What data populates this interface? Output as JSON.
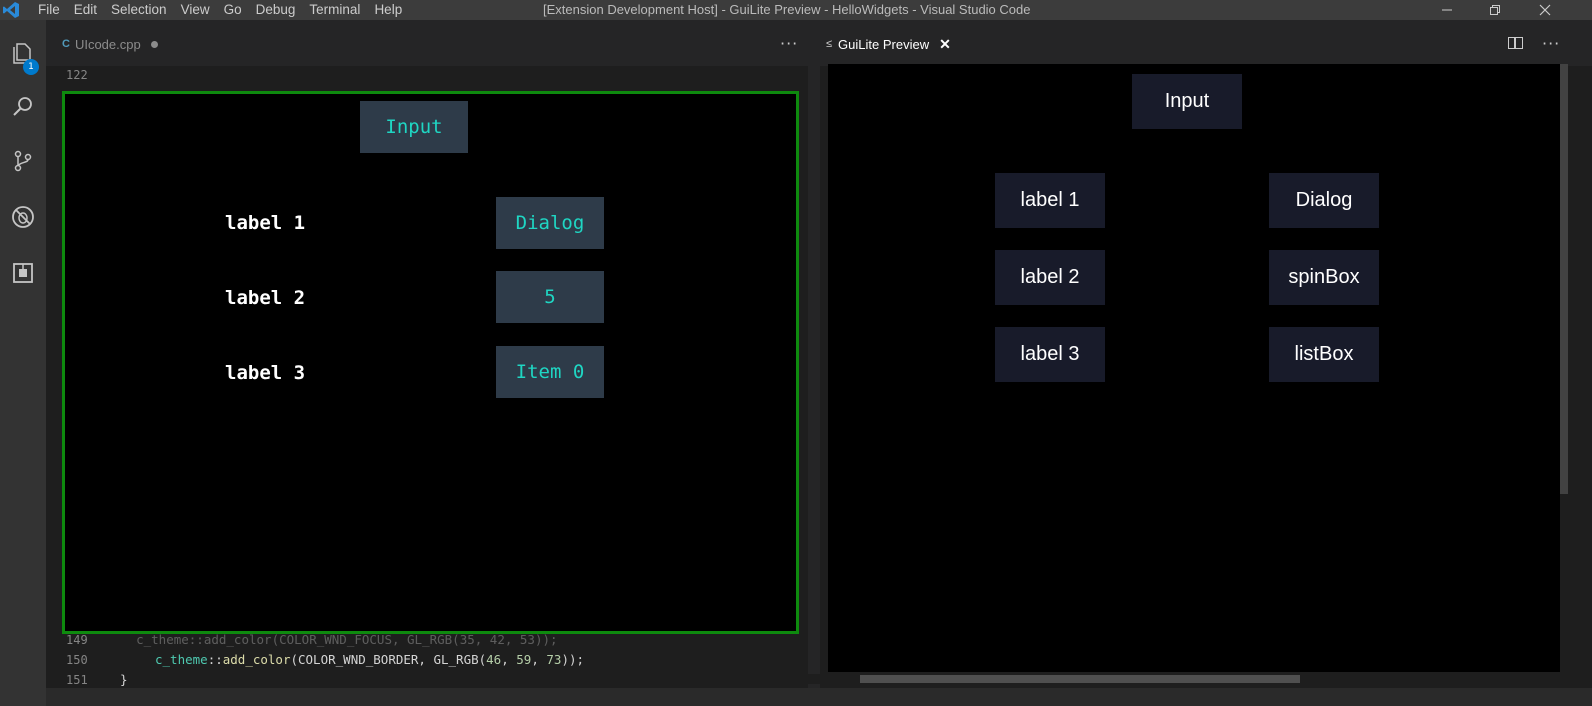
{
  "window": {
    "title": "[Extension Development Host] - GuiLite Preview - HelloWidgets - Visual Studio Code",
    "menu": [
      "File",
      "Edit",
      "Selection",
      "View",
      "Go",
      "Debug",
      "Terminal",
      "Help"
    ],
    "controls": [
      "minimize-icon",
      "restore-icon",
      "close-icon"
    ]
  },
  "activity_bar": {
    "items": [
      "files-icon",
      "search-icon",
      "source-control-icon",
      "debug-icon",
      "extensions-icon"
    ],
    "explorer_badge": "1"
  },
  "left_editor": {
    "tab_label": "UIcode.cpp",
    "tab_dirty": true,
    "line_numbers": [
      "122",
      "149",
      "150",
      "151"
    ],
    "code": {
      "line149": "    c_theme::add_color(COLOR_WND_FOCUS, GL_RGB(35, 42, 53));",
      "line150_class": "c_theme",
      "line150_sep": "::",
      "line150_fn": "add_color",
      "line150_args": "(COLOR_WND_BORDER, GL_RGB(",
      "line150_n1": "46",
      "line150_n2": "59",
      "line150_n3": "73",
      "line150_end": "));",
      "line151": "}"
    },
    "canvas": {
      "input_button": "Input",
      "labels": [
        "label 1",
        "label 2",
        "label 3"
      ],
      "buttons": [
        "Dialog",
        "5",
        "Item 0"
      ]
    }
  },
  "right_editor": {
    "tab_label": "GuiLite Preview",
    "preview": {
      "input_button": "Input",
      "labels": [
        "label 1",
        "label 2",
        "label 3"
      ],
      "buttons": [
        "Dialog",
        "spinBox",
        "listBox"
      ]
    }
  },
  "colors": {
    "canvas_border": "#0e8a0e",
    "widget_bg": "#2e3b49",
    "widget_text": "#1fd6c3",
    "preview_widget_bg": "#181b2a"
  }
}
